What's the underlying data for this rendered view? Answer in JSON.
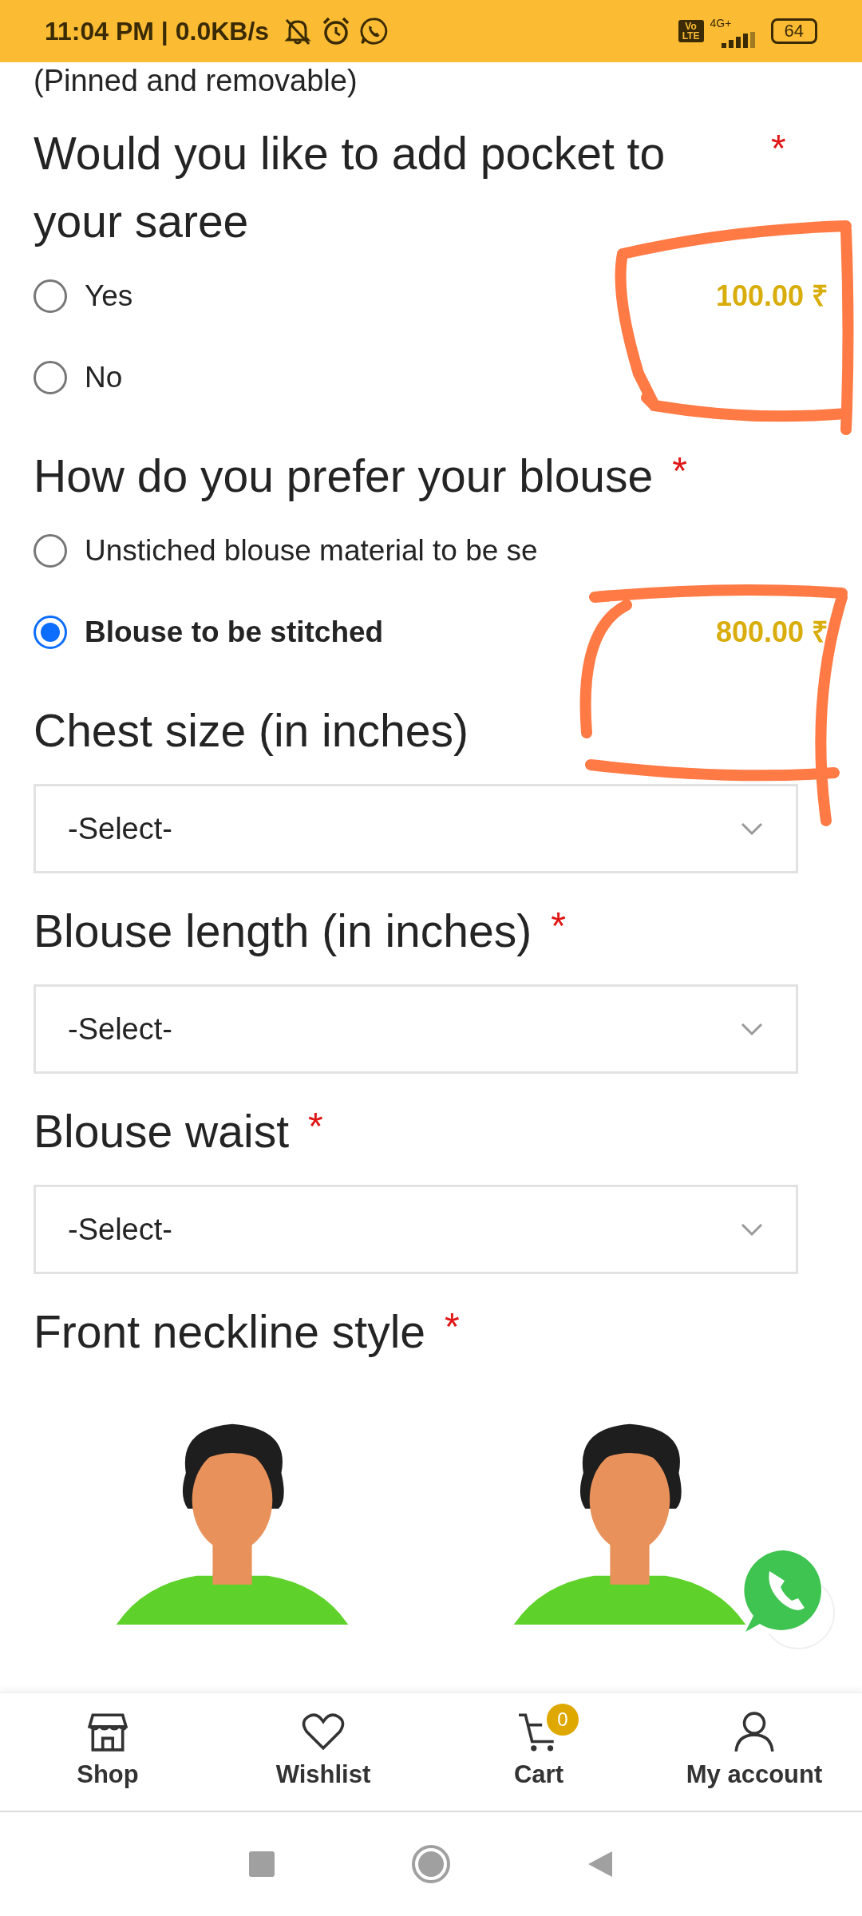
{
  "status_bar": {
    "time": "11:04 PM | 0.0KB/s",
    "volte": "Vo LTE",
    "network": "4G+",
    "battery": "64"
  },
  "note": "(Pinned and removable)",
  "questions": [
    {
      "kind": "radio",
      "title": "Would you like to add pocket to your saree",
      "required_mark": "*",
      "options": [
        {
          "label": "Yes",
          "selected": false,
          "price": "100.00 ₹"
        },
        {
          "label": "No",
          "selected": false
        }
      ]
    },
    {
      "kind": "radio",
      "title": "How do you prefer your blouse",
      "required_mark": "*",
      "options": [
        {
          "label": "Unstiched blouse material to be se",
          "selected": false
        },
        {
          "label": "Blouse to be stitched",
          "selected": true,
          "price": "800.00 ₹"
        }
      ]
    },
    {
      "kind": "select",
      "title": "Chest size (in inches)",
      "value": "-Select-"
    },
    {
      "kind": "select",
      "title": "Blouse length (in inches)",
      "required_mark": "*",
      "value": "-Select-"
    },
    {
      "kind": "select",
      "title": "Blouse waist",
      "required_mark": "*",
      "value": "-Select-"
    },
    {
      "kind": "images",
      "title": "Front neckline style",
      "required_mark": "*"
    }
  ],
  "bottom_nav": [
    {
      "kind": "shop",
      "label": "Shop"
    },
    {
      "kind": "wishlist",
      "label": "Wishlist"
    },
    {
      "kind": "cart",
      "label": "Cart",
      "badge": "0"
    },
    {
      "kind": "account",
      "label": "My account"
    }
  ]
}
